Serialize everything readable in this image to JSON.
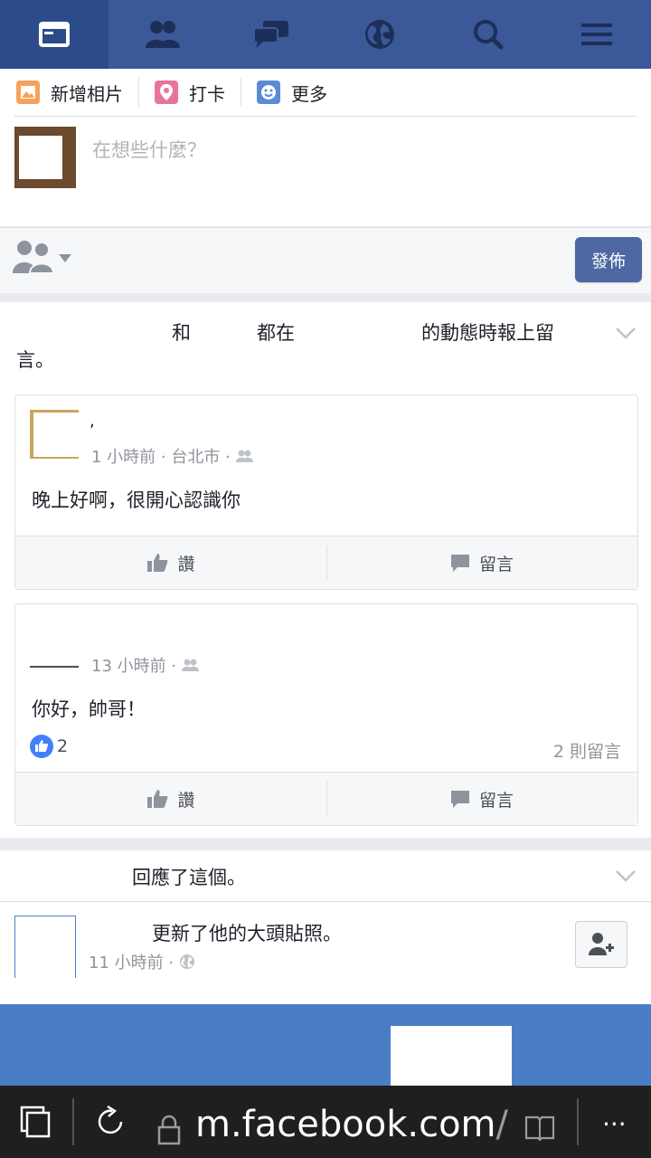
{
  "nav": {
    "items": [
      "news-feed",
      "friend-requests",
      "messages",
      "notifications",
      "search",
      "menu"
    ]
  },
  "composer": {
    "add_photo": "新增相片",
    "check_in": "打卡",
    "more": "更多",
    "placeholder": "在想些什麼？",
    "post_button": "發佈"
  },
  "story1": {
    "header_and": "和",
    "header_both_on": "都在",
    "header_timeline": "的動態時報上留",
    "header_tail": "言。",
    "posts": [
      {
        "author_mark": ",",
        "meta": "1 小時前 · 台北市 ·",
        "message": "晚上好啊，很開心認識你",
        "like": "讚",
        "comment": "留言"
      },
      {
        "meta": "13 小時前 ·",
        "message": "你好，帥哥！",
        "likes_count": "2",
        "comments_count": "2 則留言",
        "like": "讚",
        "comment": "留言"
      }
    ]
  },
  "story2": {
    "reacted": "回應了這個。",
    "updated": "更新了他的大頭貼照。",
    "meta": "11 小時前 ·"
  },
  "browser": {
    "url_host": "m.facebook.com",
    "url_tail": "/",
    "more": "..."
  },
  "colors": {
    "brand": "#3b5998",
    "like_blue": "#4080ff",
    "post_button": "#4e69a2"
  }
}
